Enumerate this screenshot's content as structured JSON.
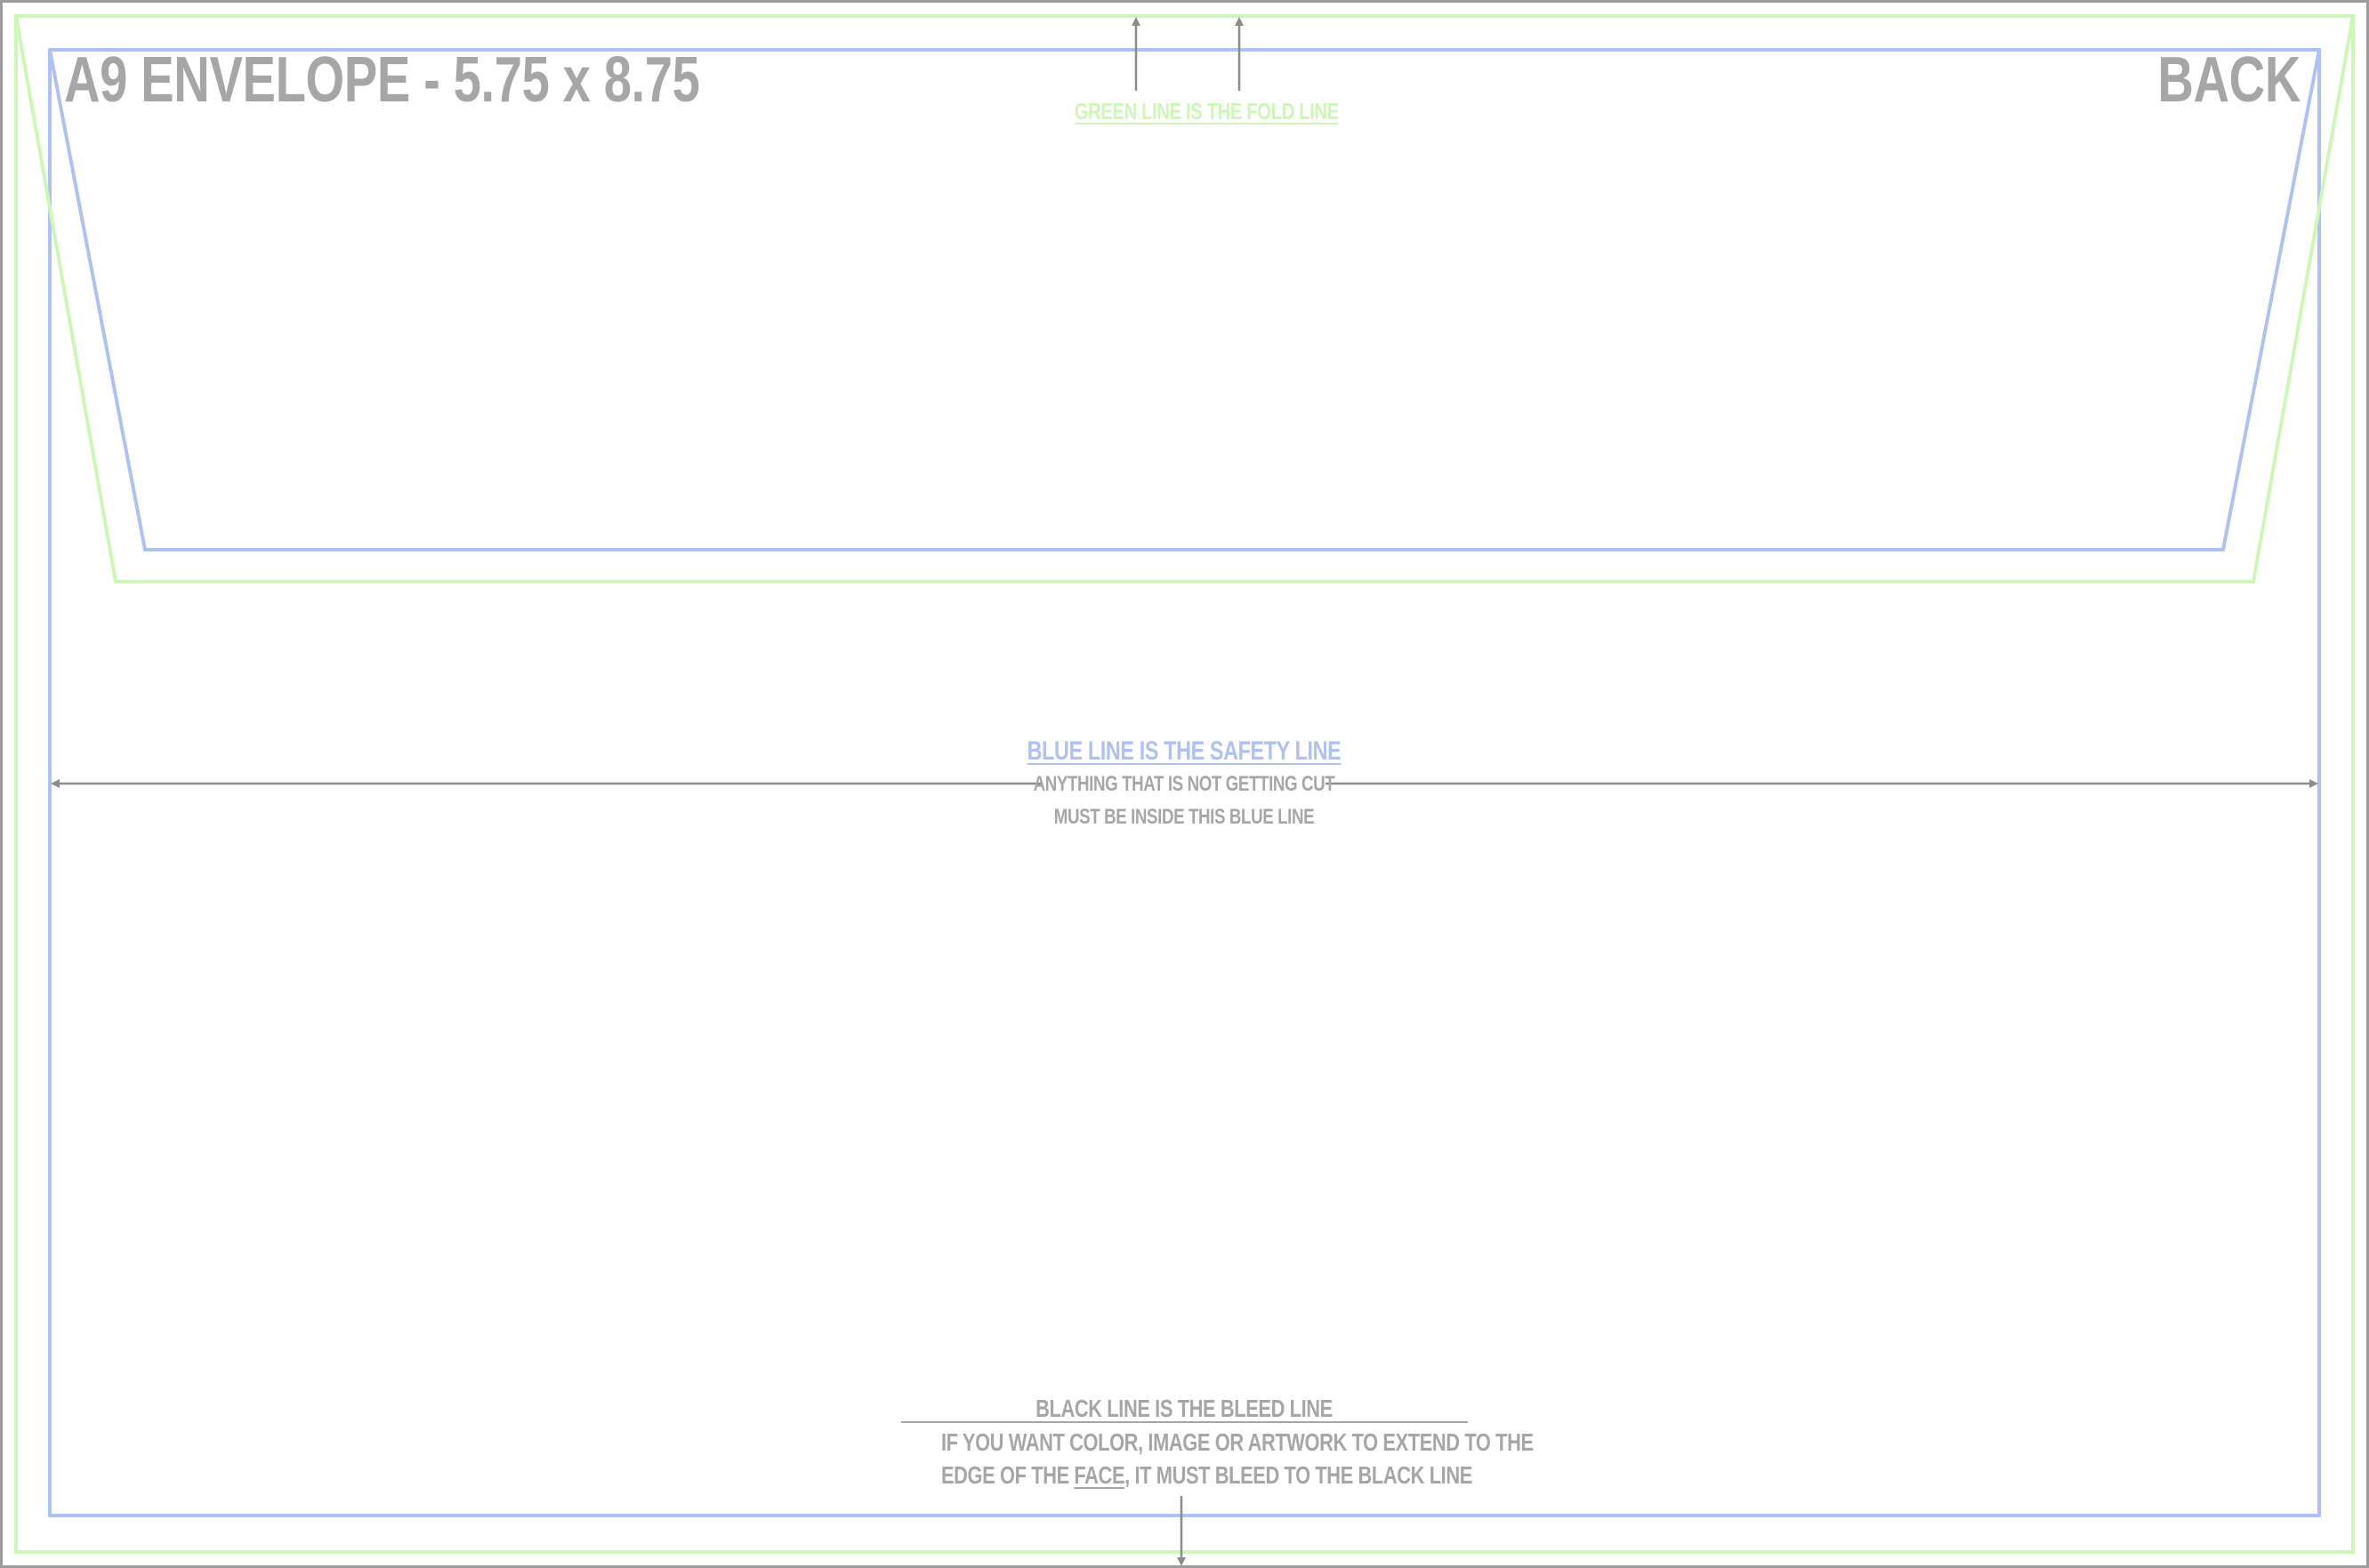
{
  "template": {
    "title": "A9 ENVELOPE - 5.75 x 8.75",
    "side": "BACK"
  },
  "fold": {
    "note": "GREEN LINE IS THE FOLD LINE"
  },
  "safety": {
    "title": "BLUE LINE IS THE SAFETY LINE",
    "line1": "ANYTHING THAT IS NOT GETTING CUT",
    "line2": "MUST BE INSIDE THIS BLUE LINE"
  },
  "bleed": {
    "title": "BLACK LINE IS THE BLEED LINE",
    "line1": "IF YOU WANT COLOR, IMAGE OR ARTWORK TO EXTEND TO THE",
    "line2_prefix": "EDGE OF THE ",
    "line2_emphasis": "FACE",
    "line2_suffix": ", IT MUST BLEED TO THE BLACK LINE"
  },
  "colors": {
    "text_gray": "#a6a6a6",
    "bleed_line": "#9b9b9b",
    "fold_green": "#ccf7b5",
    "safety_blue": "#aec1f4",
    "arrow_gray": "#8c8c8c",
    "background": "#ffffff"
  }
}
